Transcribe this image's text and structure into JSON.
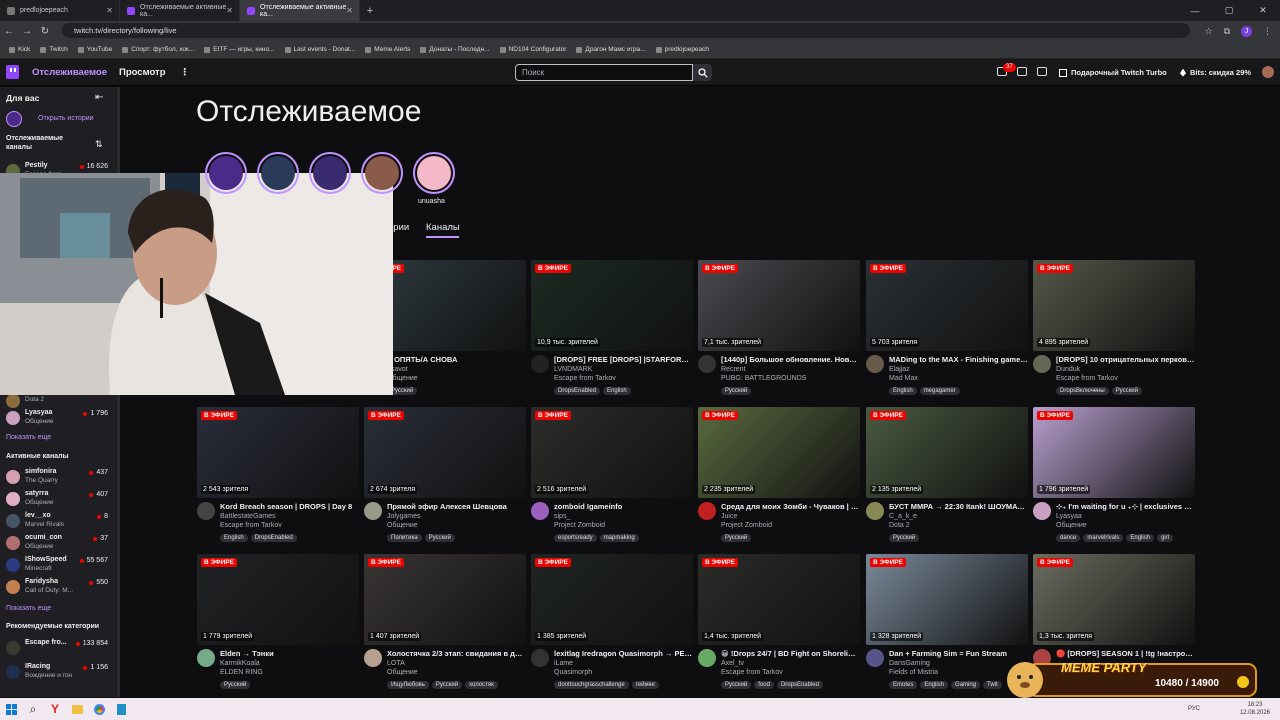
{
  "browser": {
    "tabs": [
      {
        "title": "predlojoepeach",
        "active": false
      },
      {
        "title": "Отслеживаемые активные ка...",
        "active": false
      },
      {
        "title": "Отслеживаемые активные ка...",
        "active": true
      }
    ],
    "url": "twitch.tv/directory/following/live",
    "bookmarks": [
      "Kick",
      "Twitch",
      "YouTube",
      "Спорт: футбол, хок...",
      "EITF — игры, кино...",
      "Last events - Donat...",
      "Meme Alerts",
      "Донаты - Последн...",
      "ND104 Configurator",
      "Драгон Мамс игра...",
      "predlojoepeach"
    ],
    "profile_initial": "J"
  },
  "topnav": {
    "following": "Отслеживаемое",
    "browse": "Просмотр",
    "search_placeholder": "Поиск",
    "notif_count": "37",
    "turbo": "Подарочный Twitch Turbo",
    "bits": "Bits: скидка 29%"
  },
  "sidebar": {
    "for_you": "Для вас",
    "open_stories": "Открыть истории",
    "followed_channels": "Отслеживаемые каналы",
    "followed": [
      {
        "name": "Pestily",
        "game": "Escape from...",
        "viewers": "16 626",
        "color": "#5d6b3f"
      },
      {
        "name": "",
        "game": "Dota 2",
        "viewers": "",
        "color": "#8a6d3b"
      },
      {
        "name": "Lyasyaa",
        "game": "Общение",
        "viewers": "1 796",
        "color": "#caa0c0"
      }
    ],
    "show_more": "Показать еще",
    "active_channels": "Активные каналы",
    "active": [
      {
        "name": "simfonira",
        "game": "The Quarry",
        "viewers": "437",
        "color": "#d4a0b0"
      },
      {
        "name": "satyrra",
        "game": "Общение",
        "viewers": "407",
        "color": "#e0b0c8"
      },
      {
        "name": "lev__xo",
        "game": "Marvel Rivals",
        "viewers": "8",
        "color": "#445566"
      },
      {
        "name": "ocumi_con",
        "game": "Общение",
        "viewers": "37",
        "color": "#b07070"
      },
      {
        "name": "IShowSpeed",
        "game": "Minecraft",
        "viewers": "55 567",
        "color": "#2a3a80"
      },
      {
        "name": "Faridysha",
        "game": "Call of Duty: M...",
        "viewers": "550",
        "color": "#c08050"
      }
    ],
    "show_more_2": "Показать еще",
    "recommended_categories": "Рекомендуемые категории",
    "categories": [
      {
        "name": "Escape fro...",
        "game": "",
        "viewers": "133 854",
        "color": "#3a3a30"
      },
      {
        "name": "IRacing",
        "game": "Вождение и гон",
        "viewers": "1 156",
        "color": "#1d3050"
      }
    ]
  },
  "main": {
    "title": "Отслеживаемое",
    "stories": [
      {
        "name": "",
        "color": "#4b2a8a"
      },
      {
        "name": "",
        "color": "#2a3a5a"
      },
      {
        "name": "",
        "color": "#3a2a70"
      },
      {
        "name": "r...",
        "color": "#8a5a4a"
      },
      {
        "name": "unuasha",
        "color": "#f4b8c8"
      }
    ],
    "filter_tabs": [
      "ории",
      "Каналы"
    ],
    "live_label": "В ЭФИРЕ",
    "cards": [
      {
        "views": "",
        "title": "Е ОПЯТЬ/А СНОВА",
        "channel": "asavot",
        "game": "Общение",
        "tags": [
          "Русский"
        ],
        "thumb": "#2e3a40",
        "avatar": "#556"
      },
      {
        "views": "10,9 тыс. зрителей",
        "title": "[DROPS] FREE [DROPS] |STARFORGE |...",
        "channel": "LVNDMARK",
        "game": "Escape from Tarkov",
        "tags": [
          "DropsEnabled",
          "English"
        ],
        "thumb": "#1c2a22",
        "avatar": "#222"
      },
      {
        "views": "7,1 тыс. зрителей",
        "title": "[1440p] Большое обновление. Новое ...",
        "channel": "Recrent",
        "game": "PUBG: BATTLEGROUNDS",
        "tags": [
          "Русский"
        ],
        "thumb": "#4a4a50",
        "avatar": "#333"
      },
      {
        "views": "5 703 зрителя",
        "title": "MADing to the MAX - Finishing game, h...",
        "channel": "Elajjaz",
        "game": "Mad Max",
        "tags": [
          "English",
          "megagamer"
        ],
        "thumb": "#2a3035",
        "avatar": "#6a5a4a"
      },
      {
        "views": "4 895 зрителей",
        "title": "[DROPS] 10 отрицательных перков д...",
        "channel": "Dunduk",
        "game": "Escape from Tarkov",
        "tags": [
          "DropsВключены",
          "Русский"
        ],
        "thumb": "#55584a",
        "avatar": "#665"
      },
      {
        "views": "2 543 зрителя",
        "title": "Kord Breach season | DROPS | Day 8",
        "channel": "BattlestateGames",
        "game": "Escape from Tarkov",
        "tags": [
          "English",
          "DropsEnabled"
        ],
        "thumb": "#2a2d3a",
        "avatar": "#444"
      },
      {
        "views": "2 674 зрителя",
        "title": "Прямой эфир Алексея Шевцова",
        "channel": "Jolygames",
        "game": "Общение",
        "tags": [
          "Политика",
          "Русский"
        ],
        "thumb": "#2a2e38",
        "avatar": "#998"
      },
      {
        "views": "2 516 зрителей",
        "title": "zomboid Igameinfo",
        "channel": "sips_",
        "game": "Project Zomboid",
        "tags": [
          "esportsready",
          "mapmaking"
        ],
        "thumb": "#2c2d2a",
        "avatar": "#9b5fc0"
      },
      {
        "views": "2 235 зрителей",
        "title": "Среда для моих Зомби - Чуваков | !In...",
        "channel": "Juice",
        "game": "Project Zomboid",
        "tags": [
          "Русский"
        ],
        "thumb": "#5a6a40",
        "avatar": "#c02020"
      },
      {
        "views": "2 135 зрителей",
        "title": "БУСТ ММРА → 22:30 Itank! ШОУМАТЧ...",
        "channel": "C_a_k_e",
        "game": "Dota 2",
        "tags": [
          "Русский"
        ],
        "thumb": "#4a5a40",
        "avatar": "#885"
      },
      {
        "views": "1 796 зрителей",
        "title": "⊹₊ I'm waiting for u ₊⊹ | exclusives → !l...",
        "channel": "Lyasyaa",
        "game": "Общение",
        "tags": [
          "dance",
          "marvelrivals",
          "English",
          "girl"
        ],
        "thumb": "#b9a0d0",
        "avatar": "#caa0c0"
      },
      {
        "views": "1 779 зрителей",
        "title": "Elden → Тэнки",
        "channel": "KarmikKoala",
        "game": "ELDEN RING",
        "tags": [
          "Русский"
        ],
        "thumb": "#202326",
        "avatar": "#7a8"
      },
      {
        "views": "1 407 зрителей",
        "title": "Холостячка 2/3 этап: свидания в дис...",
        "channel": "LOTA",
        "game": "Общение",
        "tags": [
          "ИщуЛюбовь",
          "Русский",
          "холостяк"
        ],
        "thumb": "#3a3535",
        "avatar": "#b8a090"
      },
      {
        "views": "1 385 зрителей",
        "title": "lexitlag Iredragon Quasimorph → PEAK...",
        "channel": "iLame",
        "game": "Quasimorph",
        "tags": [
          "donttouchgrasschallenge",
          "геймінг"
        ],
        "thumb": "#1f2423",
        "avatar": "#333"
      },
      {
        "views": "1,4 тыс. зрителей",
        "title": "😀 !Drops 24/7 | BD Fight on Shoreline ...",
        "channel": "Axel_tv",
        "game": "Escape from Tarkov",
        "tags": [
          "Русский",
          "food",
          "DropsEnabled"
        ],
        "thumb": "#2a2c28",
        "avatar": "#6a6"
      },
      {
        "views": "1 328 зрителей",
        "title": "Dan + Farming Sim = Fun Stream",
        "channel": "DansGaming",
        "game": "Fields of Mistria",
        "tags": [
          "Emotes",
          "English",
          "Gaming",
          "Twit"
        ],
        "thumb": "#7a8a9a",
        "avatar": "#558"
      },
      {
        "views": "1,3 тыс. зрителя",
        "title": "🔴 [DROPS] SEASON 1 | !tg !настройки...",
        "channel": "",
        "game": "",
        "tags": [],
        "thumb": "#6a6d60",
        "avatar": "#a44"
      }
    ]
  },
  "overlay": {
    "meme_party": "MEME PARTY",
    "meme_progress": "10480 / 14900"
  },
  "taskbar": {
    "lang": "РУС",
    "time": "18:23",
    "date": "12.08.2026"
  }
}
